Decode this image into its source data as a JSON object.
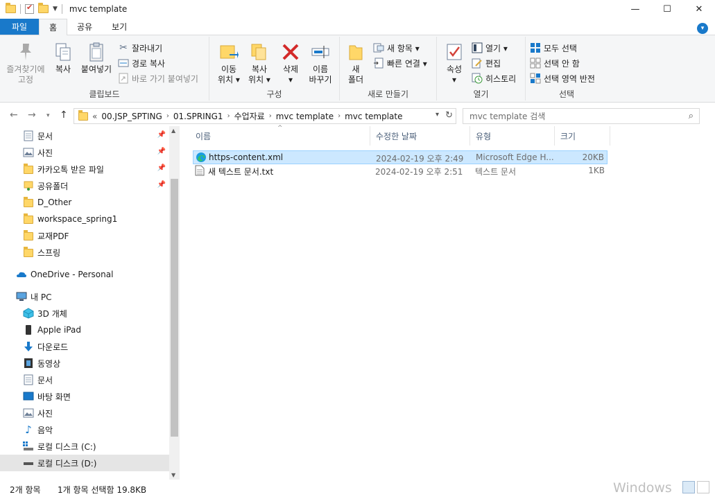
{
  "window": {
    "title": "mvc template",
    "controls": {
      "minimize": "—",
      "maximize": "☐",
      "close": "✕"
    }
  },
  "ribbon_tabs": [
    {
      "label": "파일"
    },
    {
      "label": "홈"
    },
    {
      "label": "공유"
    },
    {
      "label": "보기"
    }
  ],
  "ribbon": {
    "clipboard": {
      "label": "클립보드",
      "pin": "즐겨찾기에\n고정",
      "copy": "복사",
      "paste": "붙여넣기",
      "cut": "잘라내기",
      "copy_path": "경로 복사",
      "paste_shortcut": "바로 가기 붙여넣기"
    },
    "organize": {
      "label": "구성",
      "move_to": "이동\n위치 ▾",
      "copy_to": "복사\n위치 ▾",
      "delete": "삭제\n▾",
      "rename": "이름\n바꾸기"
    },
    "new": {
      "label": "새로 만들기",
      "new_folder": "새\n폴더",
      "new_item": "새 항목 ▾",
      "easy_access": "빠른 연결 ▾"
    },
    "open": {
      "label": "열기",
      "properties": "속성\n▾",
      "open": "열기 ▾",
      "edit": "편집",
      "history": "히스토리"
    },
    "select": {
      "label": "선택",
      "select_all": "모두 선택",
      "select_none": "선택 안 함",
      "invert": "선택 영역 반전"
    }
  },
  "address": {
    "overflow": "«",
    "crumbs": [
      "00.JSP_SPTING",
      "01.SPRING1",
      "수업자료",
      "mvc template",
      "mvc template"
    ],
    "search_placeholder": "mvc template 검색"
  },
  "nav_pane": {
    "quick_access": [
      {
        "label": "문서",
        "pinned": true
      },
      {
        "label": "사진",
        "pinned": true
      },
      {
        "label": "카카오톡 받은 파일",
        "pinned": true
      },
      {
        "label": "공유폴더",
        "pinned": true
      },
      {
        "label": "D_Other",
        "pinned": false
      },
      {
        "label": "workspace_spring1",
        "pinned": false
      },
      {
        "label": "교재PDF",
        "pinned": false
      },
      {
        "label": "스프링",
        "pinned": false
      }
    ],
    "onedrive": "OneDrive - Personal",
    "this_pc": "내 PC",
    "pc_items": [
      {
        "label": "3D 개체"
      },
      {
        "label": "Apple iPad"
      },
      {
        "label": "다운로드"
      },
      {
        "label": "동영상"
      },
      {
        "label": "문서"
      },
      {
        "label": "바탕 화면"
      },
      {
        "label": "사진"
      },
      {
        "label": "음악"
      },
      {
        "label": "로컬 디스크 (C:)"
      },
      {
        "label": "로컬 디스크 (D:)"
      }
    ]
  },
  "columns": {
    "name": "이름",
    "date": "수정한 날짜",
    "type": "유형",
    "size": "크기"
  },
  "files": [
    {
      "name": "https-content.xml",
      "date": "2024-02-19 오후 2:49",
      "type": "Microsoft Edge H...",
      "size": "20KB",
      "selected": true
    },
    {
      "name": "새 텍스트 문서.txt",
      "date": "2024-02-19 오후 2:51",
      "type": "텍스트 문서",
      "size": "1KB",
      "selected": false
    }
  ],
  "status": {
    "count": "2개 항목",
    "selection": "1개 항목 선택함 19.8KB"
  },
  "watermark": "Windows",
  "colors": {
    "accent": "#1979ca",
    "selection": "#cce8ff",
    "selection_border": "#99d1ff",
    "folder": "#ffd768"
  }
}
